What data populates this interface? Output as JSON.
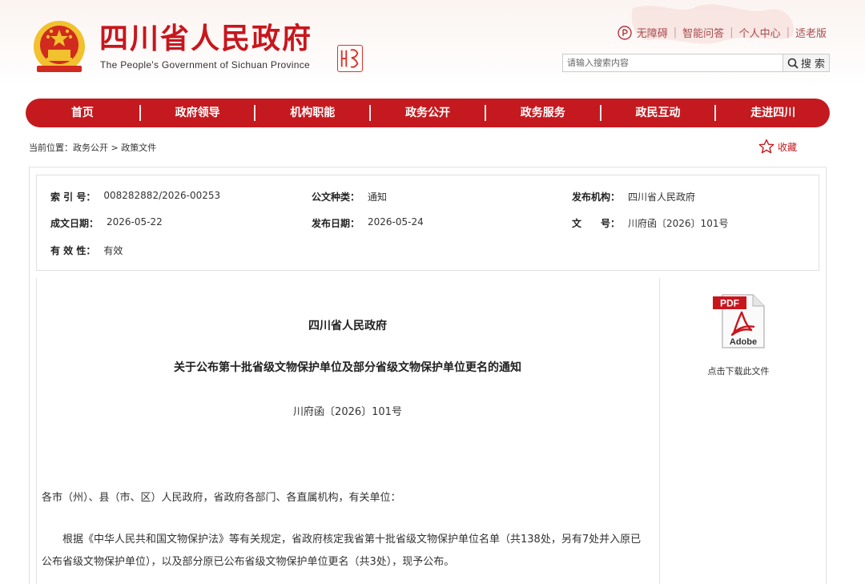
{
  "header": {
    "site_name": "四川省人民政府",
    "site_name_en": "The People's Government of Sichuan Province",
    "top_links": [
      "无障碍",
      "智能问答",
      "个人中心",
      "适老版"
    ],
    "search_placeholder": "请输入搜索内容",
    "search_button": "搜 索"
  },
  "nav": [
    "首页",
    "政府领导",
    "机构职能",
    "政务公开",
    "政务服务",
    "政民互动",
    "走进四川"
  ],
  "breadcrumb": "当前位置：政务公开 > 政策文件",
  "favorite_label": "收藏",
  "meta": {
    "index_label": "索 引 号：",
    "index_value": "008282882/2026-00253",
    "type_label": "公文种类：",
    "type_value": "通知",
    "org_label": "发布机构：",
    "org_value": "四川省人民政府",
    "created_label": "成文日期：",
    "created_value": "2026-05-22",
    "published_label": "发布日期：",
    "published_value": "2026-05-24",
    "docno_label": "文　　号：",
    "docno_value": "川府函〔2026〕101号",
    "validity_label": "有 效 性：",
    "validity_value": "有效"
  },
  "document": {
    "org": "四川省人民政府",
    "title": "关于公布第十批省级文物保护单位及部分省级文物保护单位更名的通知",
    "doc_no": "川府函〔2026〕101号",
    "salutation": "各市（州）、县（市、区）人民政府，省政府各部门、各直属机构，有关单位：",
    "paragraph": "根据《中华人民共和国文物保护法》等有关规定，省政府核定我省第十批省级文物保护单位名单（共138处，另有7处并入原已公布省级文物保护单位），以及部分原已公布省级文物保护单位更名（共3处），现予公布。"
  },
  "download": {
    "pdf_badge": "PDF",
    "adobe_label": "Adobe",
    "caption": "点击下载此文件"
  },
  "colors": {
    "brand_red": "#c41a1f",
    "emblem_gold": "#f2c12e"
  }
}
